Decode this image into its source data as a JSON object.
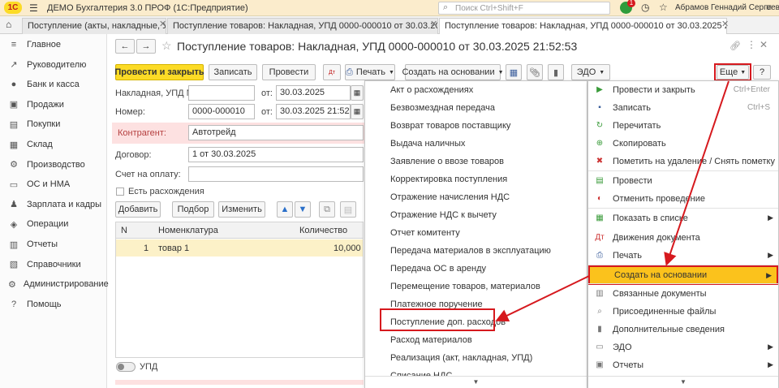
{
  "titlebar": {
    "app_title": "ДЕМО Бухгалтерия 3.0 ПРОФ  (1С:Предприятие)",
    "search_placeholder": "Поиск Ctrl+Shift+F",
    "notif_count": "1",
    "user": "Абрамов Геннадий Сергеевич"
  },
  "tabs": [
    {
      "label": "Поступление (акты, накладные, УПД)"
    },
    {
      "label": "Поступление товаров: Накладная, УПД 0000-000010 от 30.03.2025 21:52:53"
    },
    {
      "label": "Поступление товаров: Накладная, УПД 0000-000010 от 30.03.2025 21:52:53"
    }
  ],
  "sidebar": {
    "items": [
      {
        "label": "Главное",
        "icon": "≡"
      },
      {
        "label": "Руководителю",
        "icon": "↗"
      },
      {
        "label": "Банк и касса",
        "icon": "●"
      },
      {
        "label": "Продажи",
        "icon": "▣"
      },
      {
        "label": "Покупки",
        "icon": "▤"
      },
      {
        "label": "Склад",
        "icon": "▦"
      },
      {
        "label": "Производство",
        "icon": "⚙"
      },
      {
        "label": "ОС и НМА",
        "icon": "▭"
      },
      {
        "label": "Зарплата и кадры",
        "icon": "♟"
      },
      {
        "label": "Операции",
        "icon": "◈"
      },
      {
        "label": "Отчеты",
        "icon": "▥"
      },
      {
        "label": "Справочники",
        "icon": "▧"
      },
      {
        "label": "Администрирование",
        "icon": "⚙"
      },
      {
        "label": "Помощь",
        "icon": "?"
      }
    ]
  },
  "document": {
    "title": "Поступление товаров: Накладная, УПД 0000-000010 от 30.03.2025 21:52:53",
    "toolbar": {
      "post_close": "Провести и закрыть",
      "save": "Записать",
      "post": "Провести",
      "print": "Печать",
      "create_based": "Создать на основании",
      "edo": "ЭДО",
      "more": "Еще",
      "help": "?"
    },
    "fields": {
      "invoice_label": "Накладная, УПД №:",
      "invoice_value": "",
      "from_label": "от:",
      "date1": "30.03.2025",
      "number_label": "Номер:",
      "number_value": "0000-000010",
      "from_label2": "от:",
      "date2": "30.03.2025 21:52:53",
      "counterparty_label": "Контрагент:",
      "counterparty_value": "Автотрейд",
      "contract_label": "Договор:",
      "contract_value": "1 от 30.03.2025",
      "payment_label": "Счет на оплату:",
      "payment_value": "",
      "discrepancy_label": "Есть расхождения"
    },
    "table_toolbar": {
      "add": "Добавить",
      "pick": "Подбор",
      "edit": "Изменить"
    },
    "table": {
      "columns": [
        "N",
        "Номенклатура",
        "Количество"
      ],
      "rows": [
        {
          "n": "1",
          "item": "товар 1",
          "qty": "10,000"
        }
      ]
    },
    "upd_label": "УПД"
  },
  "create_based_menu": {
    "items": [
      "Акт о расхождениях",
      "Безвозмездная передача",
      "Возврат товаров поставщику",
      "Выдача наличных",
      "Заявление о ввозе товаров",
      "Корректировка поступления",
      "Отражение начисления НДС",
      "Отражение НДС к вычету",
      "Отчет комитенту",
      "Передача материалов в эксплуатацию",
      "Передача ОС в аренду",
      "Перемещение товаров, материалов",
      "Платежное поручение",
      "Поступление доп. расходов",
      "Расход материалов",
      "Реализация (акт, накладная, УПД)",
      "Списание НДС"
    ],
    "highlighted": "Поступление доп. расходов"
  },
  "more_menu": {
    "items": [
      {
        "label": "Провести и закрыть",
        "shortcut": "Ctrl+Enter",
        "icon": "▶",
        "color": "#3a9b3a",
        "sub": false
      },
      {
        "label": "Записать",
        "shortcut": "Ctrl+S",
        "icon": "▪",
        "color": "#3b5e9c",
        "sub": false
      },
      {
        "label": "Перечитать",
        "shortcut": "",
        "icon": "↻",
        "color": "#3a9b3a",
        "sub": false
      },
      {
        "label": "Скопировать",
        "shortcut": "",
        "icon": "⊕",
        "color": "#3a9b3a",
        "sub": false
      },
      {
        "label": "Пометить на удаление / Снять пометку",
        "shortcut": "",
        "icon": "✖",
        "color": "#cc3333",
        "sub": false
      },
      {
        "label": "Провести",
        "shortcut": "",
        "icon": "▤",
        "color": "#3a9b3a",
        "sub": false
      },
      {
        "label": "Отменить проведение",
        "shortcut": "",
        "icon": "◐",
        "color": "#cc3333",
        "sub": false
      },
      {
        "label": "Показать в списке",
        "shortcut": "",
        "icon": "▦",
        "color": "#3a9b3a",
        "sub": true
      },
      {
        "label": "Движения документа",
        "shortcut": "",
        "icon": "Дт",
        "color": "#cc3333",
        "sub": false
      },
      {
        "label": "Печать",
        "shortcut": "",
        "icon": "⎙",
        "color": "#3b5e9c",
        "sub": true
      },
      {
        "label": "Создать на основании",
        "shortcut": "",
        "icon": "",
        "color": "#333",
        "sub": true
      },
      {
        "label": "Связанные документы",
        "shortcut": "",
        "icon": "▥",
        "color": "#777",
        "sub": false
      },
      {
        "label": "Присоединенные файлы",
        "shortcut": "",
        "icon": "⌕",
        "color": "#777",
        "sub": false
      },
      {
        "label": "Дополнительные сведения",
        "shortcut": "",
        "icon": "▮",
        "color": "#777",
        "sub": false
      },
      {
        "label": "ЭДО",
        "shortcut": "",
        "icon": "▭",
        "color": "#777",
        "sub": true
      },
      {
        "label": "Отчеты",
        "shortcut": "",
        "icon": "▣",
        "color": "#777",
        "sub": true
      }
    ],
    "highlighted": "Создать на основании"
  },
  "colors": {
    "accent_yellow": "#fcdb26",
    "highlight_red": "#d6191e",
    "menu_highlight": "#fbc21c",
    "counterparty_bg": "#fde1e1"
  }
}
